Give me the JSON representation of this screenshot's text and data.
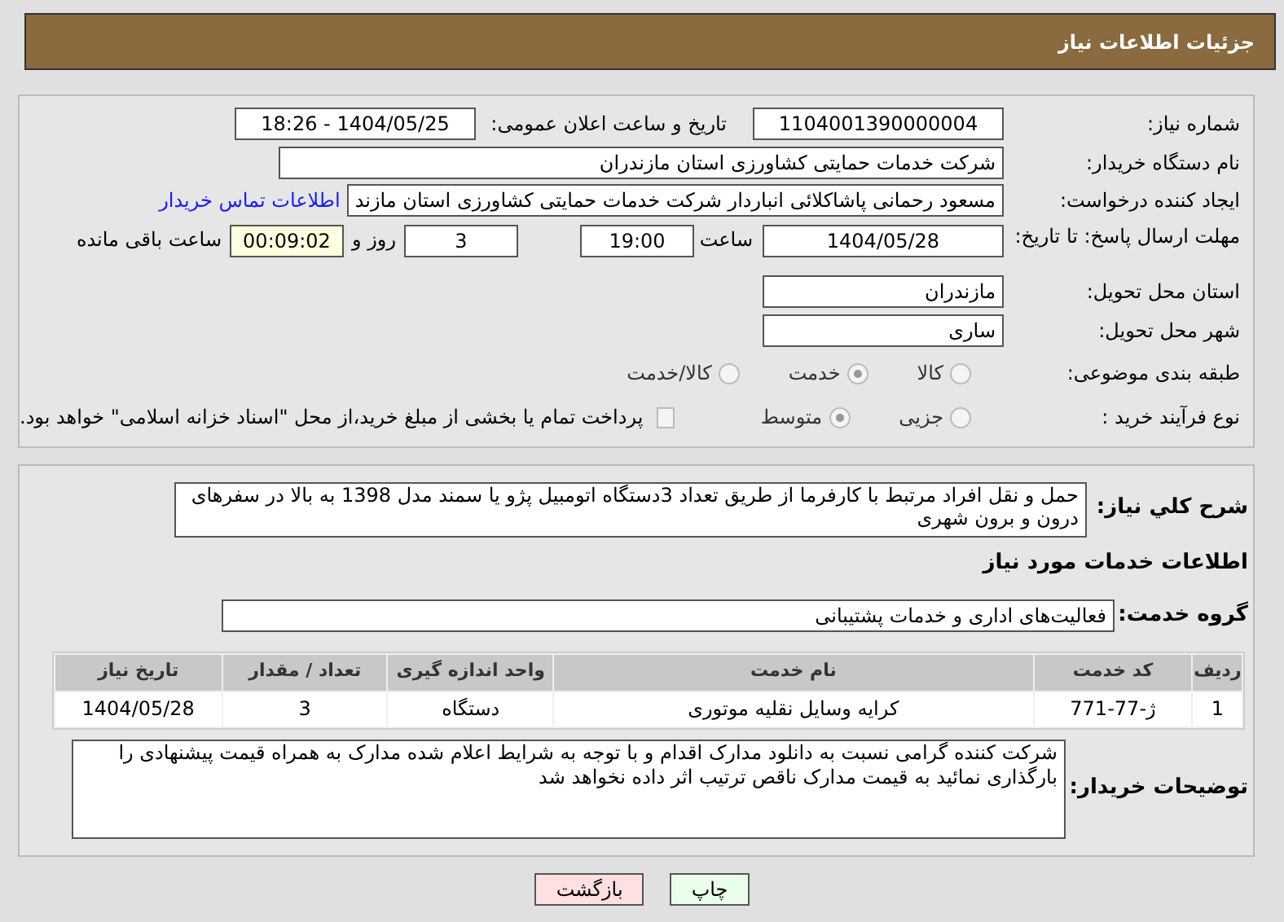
{
  "header": {
    "title": "جزئیات اطلاعات نیاز"
  },
  "details": {
    "need_number": {
      "label": "شماره نیاز:",
      "value": "1104001390000004"
    },
    "announce": {
      "label": "تاریخ و ساعت اعلان عمومی:",
      "value": "1404/05/25 - 18:26"
    },
    "buyer": {
      "label": "نام دستگاه خریدار:",
      "value": "شرکت خدمات حمایتی کشاورزی استان مازندران"
    },
    "requester": {
      "label": "ایجاد کننده درخواست:",
      "value": "مسعود رحمانی پاشاکلائی انباردار شرکت خدمات حمایتی کشاورزی استان مازند",
      "link": "اطلاعات تماس خریدار"
    },
    "deadline": {
      "label": "مهلت ارسال پاسخ: تا تاریخ:",
      "date": "1404/05/28",
      "time_label": "ساعت",
      "time": "19:00",
      "days": "3",
      "days_label": "روز و",
      "remaining": "00:09:02",
      "remaining_label": "ساعت باقی مانده"
    },
    "province": {
      "label": "استان محل تحویل:",
      "value": "مازندران"
    },
    "city": {
      "label": "شهر محل تحویل:",
      "value": "ساری"
    },
    "category": {
      "label": "طبقه بندی موضوعی:",
      "options": [
        {
          "label": "کالا",
          "selected": false
        },
        {
          "label": "خدمت",
          "selected": true
        },
        {
          "label": "کالا/خدمت",
          "selected": false
        }
      ]
    },
    "process": {
      "label": "نوع فرآیند خرید :",
      "options": [
        {
          "label": "جزیی",
          "selected": false
        },
        {
          "label": "متوسط",
          "selected": true
        }
      ],
      "payment": {
        "checked": false,
        "label": "پرداخت تمام یا بخشی از مبلغ خرید،از محل \"اسناد خزانه اسلامی\" خواهد بود."
      }
    }
  },
  "services": {
    "summary": {
      "label": "شرح کلي نیاز:",
      "value": "حمل و نقل افراد مرتبط با کارفرما از طریق تعداد 3دستگاه اتومبیل پژو یا سمند مدل 1398 به بالا در سفرهای درون و برون شهری"
    },
    "section_title": "اطلاعات خدمات مورد نیاز",
    "group": {
      "label": "گروه خدمت:",
      "value": "فعالیت‌های اداری و خدمات پشتیبانی"
    },
    "table": {
      "columns": [
        "ردیف",
        "کد خدمت",
        "نام خدمت",
        "واحد اندازه گیری",
        "تعداد / مقدار",
        "تاریخ نیاز"
      ],
      "rows": [
        [
          "1",
          "ژ-77-771",
          "کرایه وسایل نقلیه موتوری",
          "دستگاه",
          "3",
          "1404/05/28"
        ]
      ]
    },
    "notes": {
      "label": "توضیحات خریدار:",
      "value": "شرکت کننده گرامی نسبت به دانلود مدارک اقدام و با توجه به شرایط اعلام شده مدارک به همراه قیمت پیشنهادی را بارگذاری نمائید به قیمت مدارک ناقص ترتیب اثر داده نخواهد شد"
    }
  },
  "buttons": [
    {
      "label": "چاپ",
      "kind": "print"
    },
    {
      "label": "بازگشت",
      "kind": "back"
    }
  ]
}
